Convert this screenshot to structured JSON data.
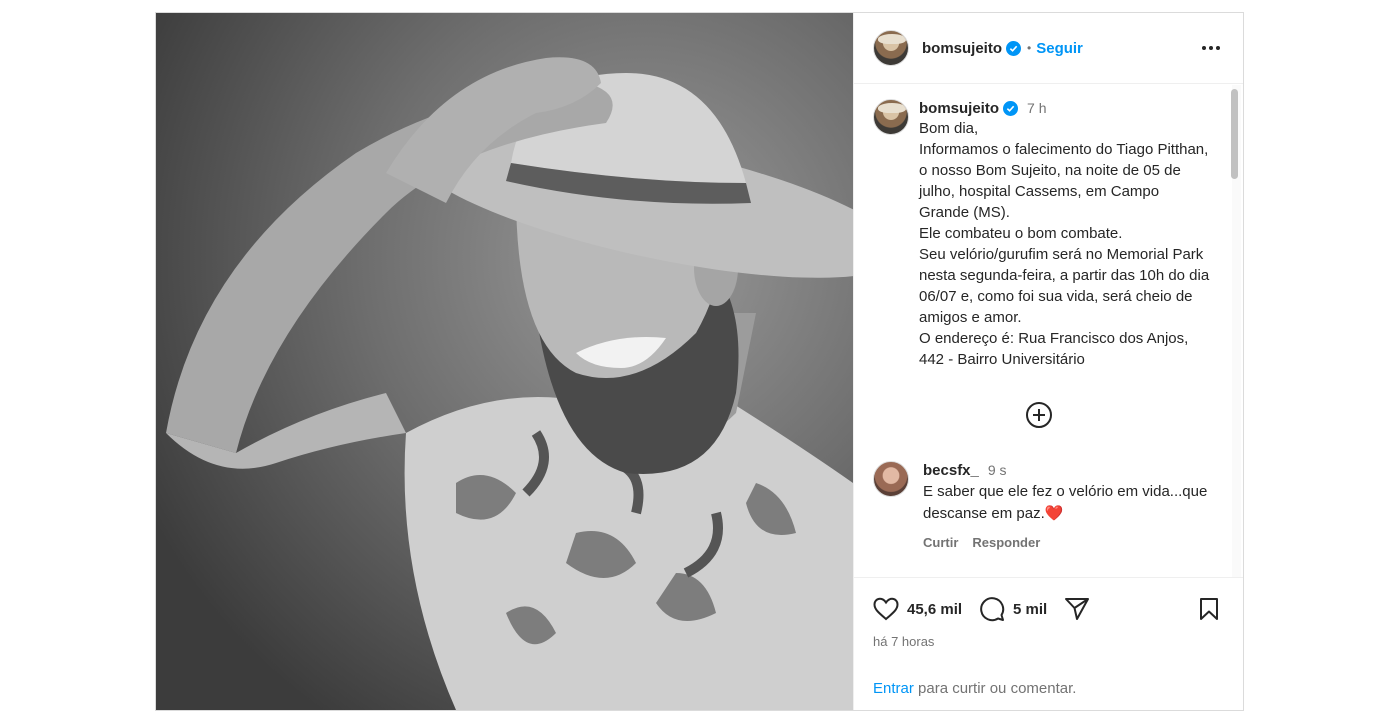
{
  "photo": {
    "alt_description": ""
  },
  "header": {
    "username": "bomsujeito",
    "separator": "•",
    "follow_label": "Seguir",
    "more_icon": "ellipsis-icon"
  },
  "caption": {
    "username": "bomsujeito",
    "time": "7 h",
    "text": "Bom dia,\nInformamos o falecimento do Tiago Pitthan, o nosso Bom Sujeito, na noite de 05 de julho, hospital Cassems, em Campo Grande (MS).\nEle combateu o bom combate.\nSeu velório/gurufim será no Memorial Park nesta segunda-feira, a partir das 10h do dia 06/07 e, como foi sua vida, será cheio de amigos e amor.\nO endereço é: Rua Francisco dos Anjos, 442 - Bairro Universitário"
  },
  "load_more_icon": "plus-circle-icon",
  "comments": [
    {
      "username": "becsfx_",
      "time": "9 s",
      "text": "E saber que ele fez o velório em vida...que descanse em paz.",
      "emoji": "❤️",
      "reply_label": "Curtir",
      "respond_label": "Responder"
    }
  ],
  "actions": {
    "likes": "45,6 mil",
    "comments": "5 mil",
    "posted_ago": "há 7 horas",
    "login_link": "Entrar",
    "login_text": " para curtir ou comentar."
  },
  "colors": {
    "link": "#0095f6",
    "muted": "#737373",
    "text": "#262626",
    "border": "#dbdbdb"
  }
}
